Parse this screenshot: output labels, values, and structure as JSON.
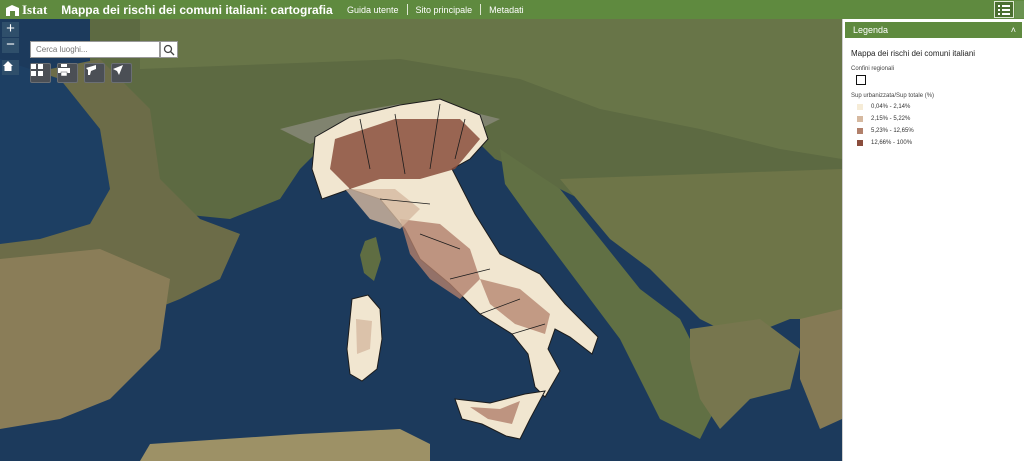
{
  "header": {
    "logo_text": "Istat",
    "title": "Mappa dei rischi dei comuni italiani: cartografia",
    "nav": [
      "Guida utente",
      "Sito principale",
      "Metadati"
    ]
  },
  "map": {
    "zoom_in": "+",
    "zoom_out": "−",
    "search_placeholder": "Cerca luoghi...",
    "tools": [
      "grid-icon",
      "print-icon",
      "measure-icon",
      "locate-icon"
    ]
  },
  "legend": {
    "header": "Legenda",
    "layer_title": "Mappa dei rischi dei comuni italiani",
    "boundary_label": "Confini regionali",
    "ratio_label": "Sup urbanizzata/Sup totale (%)",
    "classes": [
      {
        "label": "0,04% - 2,14%",
        "color": "#f6ecd7"
      },
      {
        "label": "2,15% - 5,22%",
        "color": "#d6b9a0"
      },
      {
        "label": "5,23% - 12,65%",
        "color": "#b1806b"
      },
      {
        "label": "12,66% - 100%",
        "color": "#8a4d3c"
      }
    ]
  },
  "colors": {
    "header": "#5f8a3f",
    "sea": "#1c3a5c",
    "land": "#6b6d4a"
  }
}
